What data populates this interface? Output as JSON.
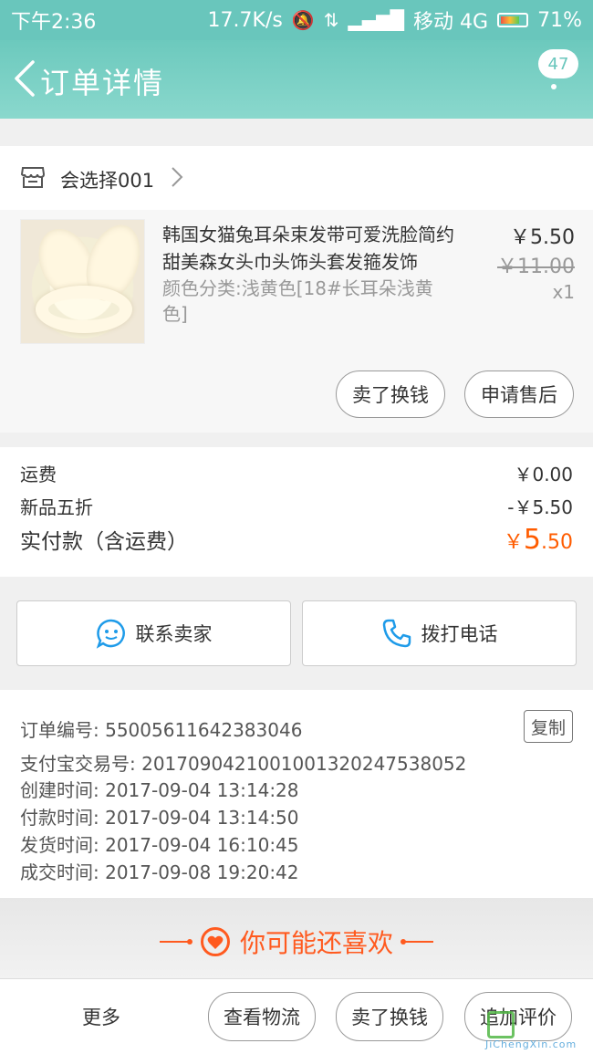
{
  "status_bar": {
    "time": "下午2:36",
    "speed": "17.7K/s",
    "carrier": "移动 4G",
    "battery": "71%"
  },
  "header": {
    "title": "订单详情",
    "badge_count": "47"
  },
  "shop": {
    "name": "会选择001"
  },
  "product": {
    "title": "韩国女猫兔耳朵束发带可爱洗脸简约甜美森女头巾头饰头套发箍发饰",
    "sku": "颜色分类:浅黄色[18#长耳朵浅黄色]",
    "price": "￥5.50",
    "original_price": "￥11.00",
    "quantity": "x1",
    "sell_button": "卖了换钱",
    "after_sale_button": "申请售后"
  },
  "fees": {
    "shipping_label": "运费",
    "shipping_value": "￥0.00",
    "discount_label": "新品五折",
    "discount_value": "-￥5.50",
    "total_label": "实付款（含运费）",
    "total_prefix": "￥",
    "total_int": "5",
    "total_dec": ".50"
  },
  "contact": {
    "seller_label": "联系卖家",
    "phone_label": "拨打电话"
  },
  "order_info": {
    "order_no": "订单编号: 55005611642383046",
    "copy_label": "复制",
    "alipay_no": "支付宝交易号: 2017090421001001320247538052",
    "created": "创建时间: 2017-09-04 13:14:28",
    "paid": "付款时间: 2017-09-04 13:14:50",
    "shipped": "发货时间: 2017-09-04 16:10:45",
    "completed": "成交时间: 2017-09-08 19:20:42"
  },
  "recommend": {
    "title": "你可能还喜欢"
  },
  "bottom_bar": {
    "more_label": "更多",
    "logistics_button": "查看物流",
    "sell_button": "卖了换钱",
    "review_button": "追加评价"
  },
  "watermark": {
    "text": "JiChengXin.com"
  },
  "colors": {
    "brand": "#69c6bc",
    "accent": "#ff5c00"
  }
}
